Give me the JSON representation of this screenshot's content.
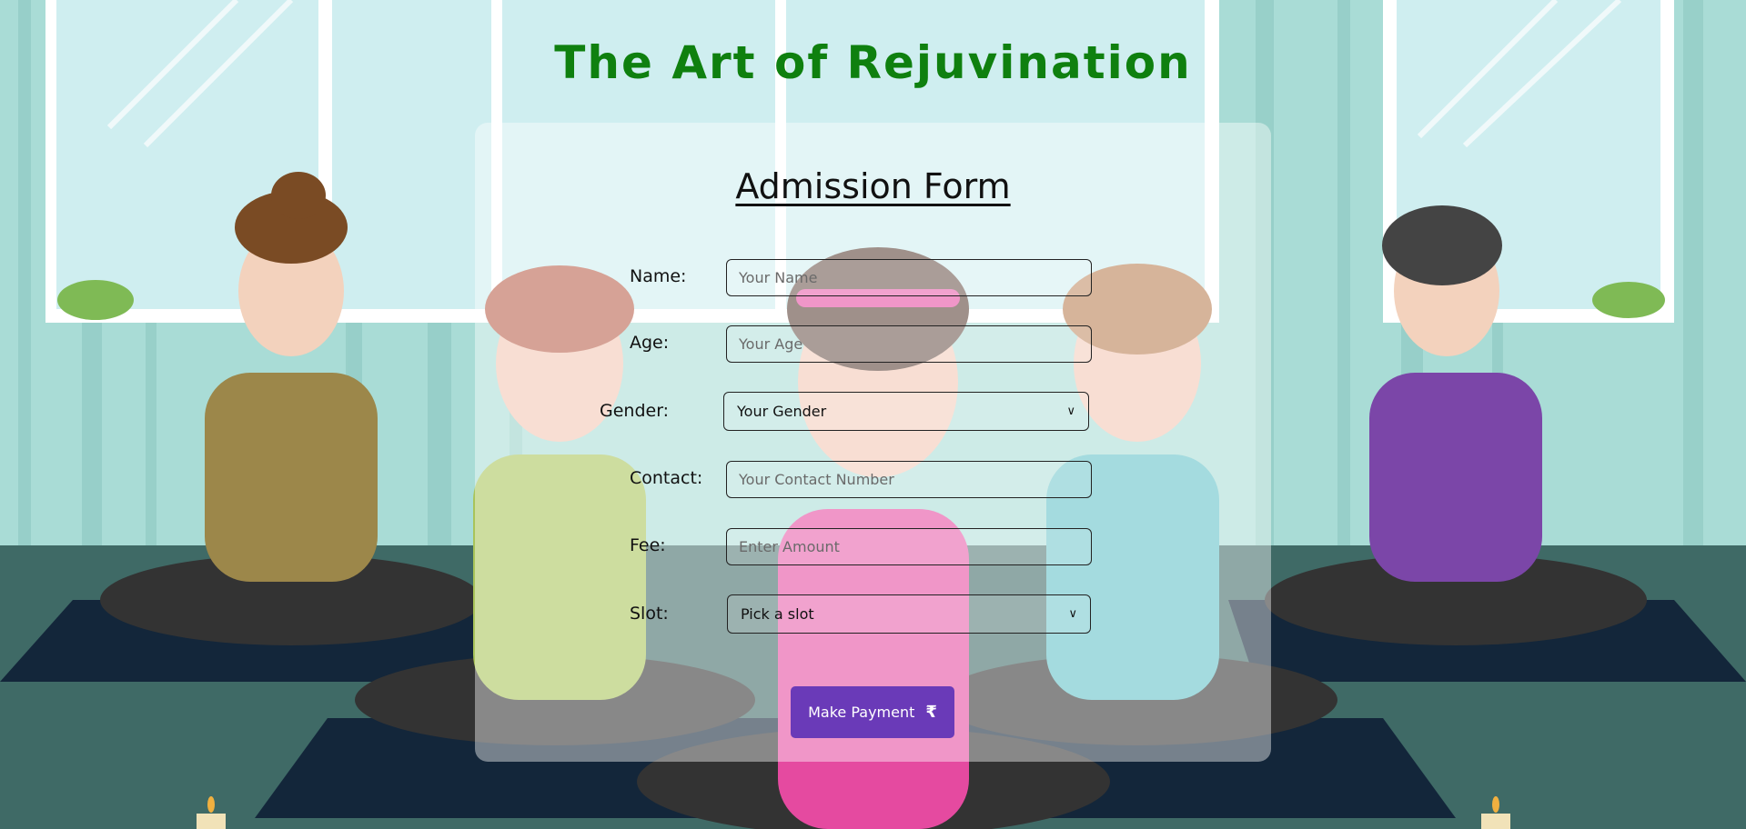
{
  "header": {
    "title": "The Art of Rejuvination"
  },
  "form": {
    "title": "Admission Form",
    "name": {
      "label": "Name:",
      "placeholder": "Your Name"
    },
    "age": {
      "label": "Age:",
      "placeholder": "Your Age"
    },
    "gender": {
      "label": "Gender:",
      "value": "Your Gender"
    },
    "contact": {
      "label": "Contact:",
      "placeholder": "Your Contact Number"
    },
    "fee": {
      "label": "Fee:",
      "placeholder": "Enter Amount"
    },
    "slot": {
      "label": "Slot:",
      "value": "Pick a slot"
    },
    "submit": {
      "label": "Make Payment",
      "icon": "rupee-icon",
      "glyph": "₹"
    }
  },
  "colors": {
    "title": "#0f800f",
    "button": "#6a3ab8",
    "wall": "#a9dcd6",
    "floor": "#3f6a66",
    "mat": "#13263a"
  }
}
